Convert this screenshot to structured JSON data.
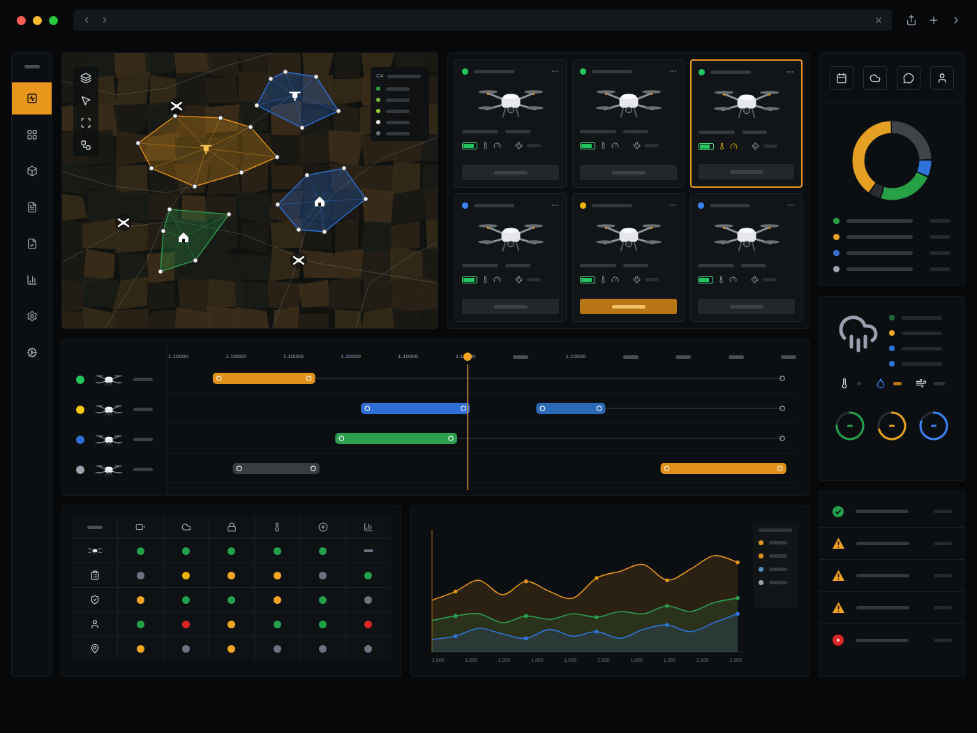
{
  "sidebar": {
    "items": [
      {
        "selected": true
      },
      {
        "selected": false
      },
      {
        "selected": false
      },
      {
        "selected": false
      },
      {
        "selected": false
      },
      {
        "selected": false
      },
      {
        "selected": false
      },
      {
        "selected": false
      }
    ]
  },
  "map": {
    "legend_label": "C4",
    "legend": [
      {
        "color": "#2ea043"
      },
      {
        "color": "#7cb342"
      },
      {
        "color": "#9acd32"
      },
      {
        "color": "#e5e7eb"
      },
      {
        "color": "#6b7280"
      }
    ],
    "zones": [
      {
        "color": "#e0921a",
        "kind": "drone"
      },
      {
        "color": "#2f6fd6",
        "kind": "drone"
      },
      {
        "color": "#2f6fd6",
        "kind": "base"
      },
      {
        "color": "#2e9e4f",
        "kind": "base"
      }
    ]
  },
  "drones": [
    {
      "status_color": "#22c55e",
      "battery": 0.85,
      "selected": false,
      "action_active": false
    },
    {
      "status_color": "#22c55e",
      "battery": 0.85,
      "selected": false,
      "action_active": false
    },
    {
      "status_color": "#22c55e",
      "battery": 0.8,
      "selected": true,
      "action_active": false
    },
    {
      "status_color": "#3b82f6",
      "battery": 0.9,
      "selected": false,
      "action_active": false
    },
    {
      "status_color": "#f5b50a",
      "battery": 0.85,
      "selected": false,
      "action_active": true
    },
    {
      "status_color": "#3b82f6",
      "battery": 0.75,
      "selected": false,
      "action_active": false
    }
  ],
  "timeline": {
    "ticks": [
      {
        "kind": "text",
        "label": "1.10000"
      },
      {
        "kind": "text",
        "label": "1.10000"
      },
      {
        "kind": "text",
        "label": "1.10000"
      },
      {
        "kind": "text",
        "label": "1.10000"
      },
      {
        "kind": "text",
        "label": "1.10000"
      },
      {
        "kind": "text",
        "label": "1.10000"
      },
      {
        "kind": "bar"
      },
      {
        "kind": "text",
        "label": "1.10000"
      },
      {
        "kind": "bar"
      },
      {
        "kind": "bar"
      },
      {
        "kind": "bar"
      },
      {
        "kind": "bar"
      }
    ],
    "now": 47.7,
    "rows": [
      {
        "color": "#22c55e",
        "segments": [
          {
            "start": 7.1,
            "end": 23.4,
            "color": "#e0921a"
          }
        ]
      },
      {
        "color": "#facc15",
        "segments": [
          {
            "start": 30.7,
            "end": 48,
            "color": "#2f6fd6"
          },
          {
            "start": 58.6,
            "end": 69.6,
            "color": "#2a6ab8"
          }
        ]
      },
      {
        "color": "#2f6fd6",
        "segments": [
          {
            "start": 26.6,
            "end": 46,
            "color": "#2e9e4f"
          }
        ]
      },
      {
        "color": "#9ca3af",
        "segments": [
          {
            "start": 10.3,
            "end": 24.1,
            "color": "#3a3d40"
          },
          {
            "start": 78.4,
            "end": 98.4,
            "color": "#e0921a"
          }
        ]
      }
    ]
  },
  "matrix": {
    "rows": [
      {
        "cells": [
          {
            "kind": "dot",
            "color": "#22a04b"
          },
          {
            "kind": "dot",
            "color": "#22a04b"
          },
          {
            "kind": "dot",
            "color": "#22a04b"
          },
          {
            "kind": "dot",
            "color": "#22a04b"
          },
          {
            "kind": "dot",
            "color": "#22a04b"
          },
          {
            "kind": "dash",
            "color": "#6b7280"
          }
        ]
      },
      {
        "cells": [
          {
            "kind": "dot",
            "color": "#6b7280"
          },
          {
            "kind": "dot",
            "color": "#eab308"
          },
          {
            "kind": "dot",
            "color": "#f5a524"
          },
          {
            "kind": "dot",
            "color": "#f5a524"
          },
          {
            "kind": "dot",
            "color": "#6b7280"
          },
          {
            "kind": "dot",
            "color": "#22a04b"
          }
        ]
      },
      {
        "cells": [
          {
            "kind": "dot",
            "color": "#f5a524"
          },
          {
            "kind": "dot",
            "color": "#22a04b"
          },
          {
            "kind": "dot",
            "color": "#22a04b"
          },
          {
            "kind": "dot",
            "color": "#f5a524"
          },
          {
            "kind": "dot",
            "color": "#22a04b"
          },
          {
            "kind": "dot",
            "color": "#6b7280"
          }
        ]
      },
      {
        "cells": [
          {
            "kind": "dot",
            "color": "#22a04b"
          },
          {
            "kind": "dot",
            "color": "#dc2626"
          },
          {
            "kind": "dot",
            "color": "#f5a524"
          },
          {
            "kind": "dot",
            "color": "#22a04b"
          },
          {
            "kind": "dot",
            "color": "#22a04b"
          },
          {
            "kind": "dot",
            "color": "#dc2626"
          }
        ]
      },
      {
        "cells": [
          {
            "kind": "dot",
            "color": "#f5a524"
          },
          {
            "kind": "dot",
            "color": "#6b7280"
          },
          {
            "kind": "dot",
            "color": "#f5a524"
          },
          {
            "kind": "dot",
            "color": "#6b7280"
          },
          {
            "kind": "dot",
            "color": "#6b7280"
          },
          {
            "kind": "dot",
            "color": "#6b7280"
          }
        ]
      }
    ]
  },
  "chart": {
    "series": [
      {
        "color": "#e0921a",
        "values": [
          40,
          48,
          58,
          45,
          57,
          48,
          42,
          60,
          66,
          72,
          58,
          68,
          80,
          74
        ]
      },
      {
        "color": "#2e9e4f",
        "values": [
          22,
          26,
          28,
          20,
          26,
          23,
          28,
          25,
          30,
          28,
          35,
          30,
          38,
          42
        ]
      },
      {
        "color": "#2f73d9",
        "values": [
          5,
          8,
          15,
          10,
          6,
          14,
          8,
          12,
          6,
          14,
          18,
          12,
          20,
          28
        ]
      }
    ],
    "x_labels": [
      "1.000",
      "1.000",
      "1.000",
      "1.000",
      "1.000",
      "1.000",
      "1.000",
      "1.000",
      "1.000",
      "1.000"
    ],
    "legend": [
      {
        "color": "#e0921a"
      },
      {
        "color": "#e0921a"
      },
      {
        "color": "#5b8fb9"
      },
      {
        "color": "#9ca3af"
      }
    ]
  },
  "donut": {
    "segments": [
      {
        "color": "#3f4449",
        "value": 0.25
      },
      {
        "color": "#2f73d9",
        "value": 0.07
      },
      {
        "color": "#27a046",
        "value": 0.23
      },
      {
        "color": "#2a2e33",
        "value": 0.05
      },
      {
        "color": "#e5a024",
        "value": 0.4
      }
    ],
    "legend": [
      {
        "color": "#27a046"
      },
      {
        "color": "#e5a024"
      },
      {
        "color": "#3b6fd6"
      },
      {
        "color": "#9ca3af"
      }
    ]
  },
  "weather": {
    "legend": [
      {
        "color": "#1f6b3a"
      },
      {
        "color": "#f5a524"
      },
      {
        "color": "#2f73d9"
      },
      {
        "color": "#2f73d9"
      }
    ],
    "gauges": [
      {
        "color": "#22a04b",
        "level": 0.75
      },
      {
        "color": "#e5a024",
        "level": 0.7
      },
      {
        "color": "#3b82f6",
        "level": 0.8
      }
    ]
  },
  "alerts": [
    {
      "kind": "ok"
    },
    {
      "kind": "warning"
    },
    {
      "kind": "warning"
    },
    {
      "kind": "warning"
    },
    {
      "kind": "error"
    }
  ]
}
